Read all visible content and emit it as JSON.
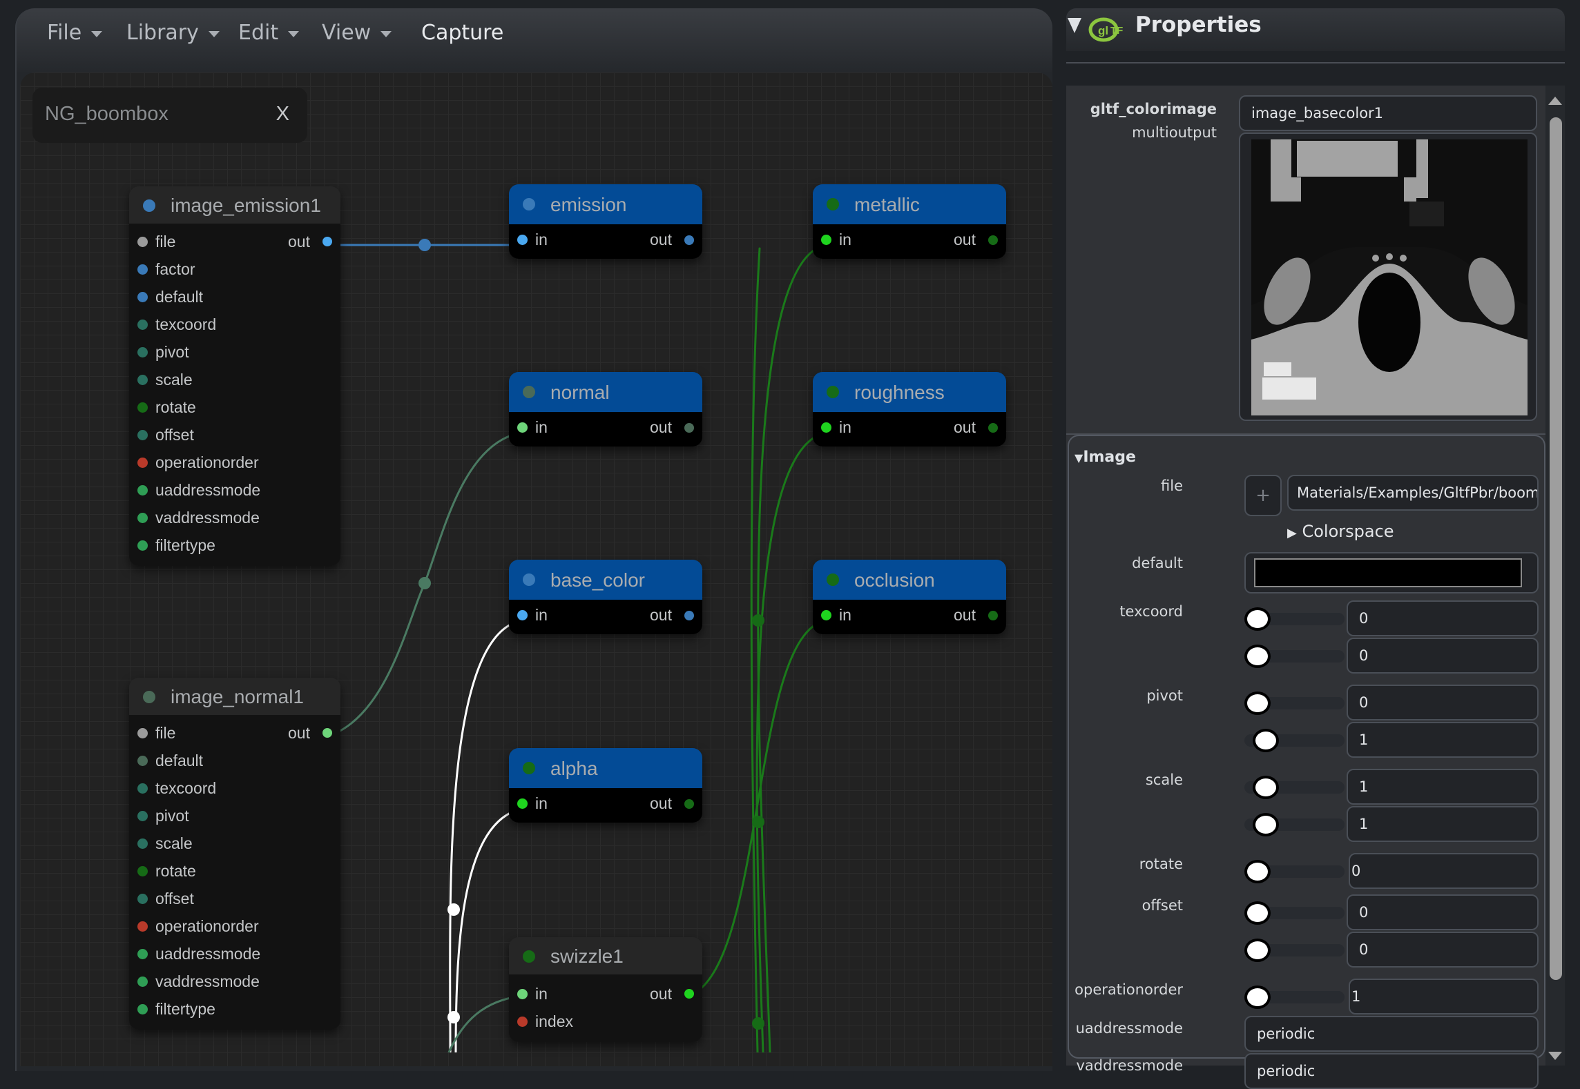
{
  "menubar": {
    "items": [
      {
        "label": "File",
        "has_dropdown": true
      },
      {
        "label": "Library",
        "has_dropdown": true
      },
      {
        "label": "Edit",
        "has_dropdown": true
      },
      {
        "label": "View",
        "has_dropdown": true
      },
      {
        "label": "Capture",
        "has_dropdown": false
      }
    ]
  },
  "graph_tab": {
    "title": "NG_boombox",
    "close_label": "X"
  },
  "nodes": {
    "image_emission1": {
      "name": "image_emission1",
      "color": "#3a7ab8",
      "output": "out",
      "inputs": [
        {
          "label": "file",
          "color": "#9b9b9b"
        },
        {
          "label": "factor",
          "color": "#3a7ab8"
        },
        {
          "label": "default",
          "color": "#3a7ab8"
        },
        {
          "label": "texcoord",
          "color": "#2a7060"
        },
        {
          "label": "pivot",
          "color": "#2a7060"
        },
        {
          "label": "scale",
          "color": "#2a7060"
        },
        {
          "label": "rotate",
          "color": "#166b16"
        },
        {
          "label": "offset",
          "color": "#2a7060"
        },
        {
          "label": "operationorder",
          "color": "#b93a2a"
        },
        {
          "label": "uaddressmode",
          "color": "#2f9e55"
        },
        {
          "label": "vaddressmode",
          "color": "#2f9e55"
        },
        {
          "label": "filtertype",
          "color": "#2f9e55"
        }
      ]
    },
    "image_normal1": {
      "name": "image_normal1",
      "color": "#4a6a58",
      "output": "out",
      "inputs": [
        {
          "label": "file",
          "color": "#9b9b9b"
        },
        {
          "label": "default",
          "color": "#4a6a58"
        },
        {
          "label": "texcoord",
          "color": "#2a7060"
        },
        {
          "label": "pivot",
          "color": "#2a7060"
        },
        {
          "label": "scale",
          "color": "#2a7060"
        },
        {
          "label": "rotate",
          "color": "#166b16"
        },
        {
          "label": "offset",
          "color": "#2a7060"
        },
        {
          "label": "operationorder",
          "color": "#b93a2a"
        },
        {
          "label": "uaddressmode",
          "color": "#2f9e55"
        },
        {
          "label": "vaddressmode",
          "color": "#2f9e55"
        },
        {
          "label": "filtertype",
          "color": "#2f9e55"
        }
      ]
    },
    "outputs": [
      {
        "name": "emission",
        "dot": "#3a7ab8",
        "in_color": "#4aa8f0",
        "out_color": "#3a7ab8",
        "in": "in",
        "out": "out"
      },
      {
        "name": "normal",
        "dot": "#4a6a58",
        "in_color": "#6ed57a",
        "out_color": "#4a6a58",
        "in": "in",
        "out": "out"
      },
      {
        "name": "base_color",
        "dot": "#3a7ab8",
        "in_color": "#4aa8f0",
        "out_color": "#3a7ab8",
        "in": "in",
        "out": "out"
      },
      {
        "name": "alpha",
        "dot": "#166b16",
        "in_color": "#1fd41f",
        "out_color": "#166b16",
        "in": "in",
        "out": "out"
      },
      {
        "name": "metallic",
        "dot": "#166b16",
        "in_color": "#1fd41f",
        "out_color": "#166b16",
        "in": "in",
        "out": "out"
      },
      {
        "name": "roughness",
        "dot": "#166b16",
        "in_color": "#1fd41f",
        "out_color": "#166b16",
        "in": "in",
        "out": "out"
      },
      {
        "name": "occlusion",
        "dot": "#166b16",
        "in_color": "#1fd41f",
        "out_color": "#166b16",
        "in": "in",
        "out": "out"
      }
    ],
    "swizzle1": {
      "name": "swizzle1",
      "color": "#166b16",
      "inputs": [
        {
          "label": "in",
          "color": "#6ed57a"
        },
        {
          "label": "index",
          "color": "#b93a2a"
        }
      ],
      "output": "out",
      "out_color": "#1fd41f"
    }
  },
  "properties": {
    "title": "Properties",
    "logo": "gltf-logo-icon",
    "node_type": "gltf_colorimage",
    "node_subtype": "multioutput",
    "node_name": "image_basecolor1",
    "preview": "texture-preview-image",
    "section": {
      "title": "Image",
      "file_label": "file",
      "file_add_label": "+",
      "file_value": "Materials/Examples/GltfPbr/boom",
      "colorspace_label": "Colorspace",
      "default_label": "default",
      "default_color": "#000000",
      "texcoord_label": "texcoord",
      "texcoord": [
        "0",
        "0"
      ],
      "pivot_label": "pivot",
      "pivot": [
        "0",
        "1"
      ],
      "scale_label": "scale",
      "scale": [
        "1",
        "1"
      ],
      "rotate_label": "rotate",
      "rotate": "0",
      "offset_label": "offset",
      "offset": [
        "0",
        "0"
      ],
      "operationorder_label": "operationorder",
      "operationorder": "1",
      "uaddressmode_label": "uaddressmode",
      "uaddressmode": "periodic",
      "vaddressmode_label": "vaddressmode",
      "vaddressmode": "periodic"
    }
  },
  "colors": {
    "wire_blue": "#3a7ab8",
    "wire_teal": "#4a7a62",
    "wire_white": "#ffffff",
    "wire_green": "#1a7a1a",
    "node_header_blue": "#034b96",
    "gltf_green": "#8cc63f"
  }
}
